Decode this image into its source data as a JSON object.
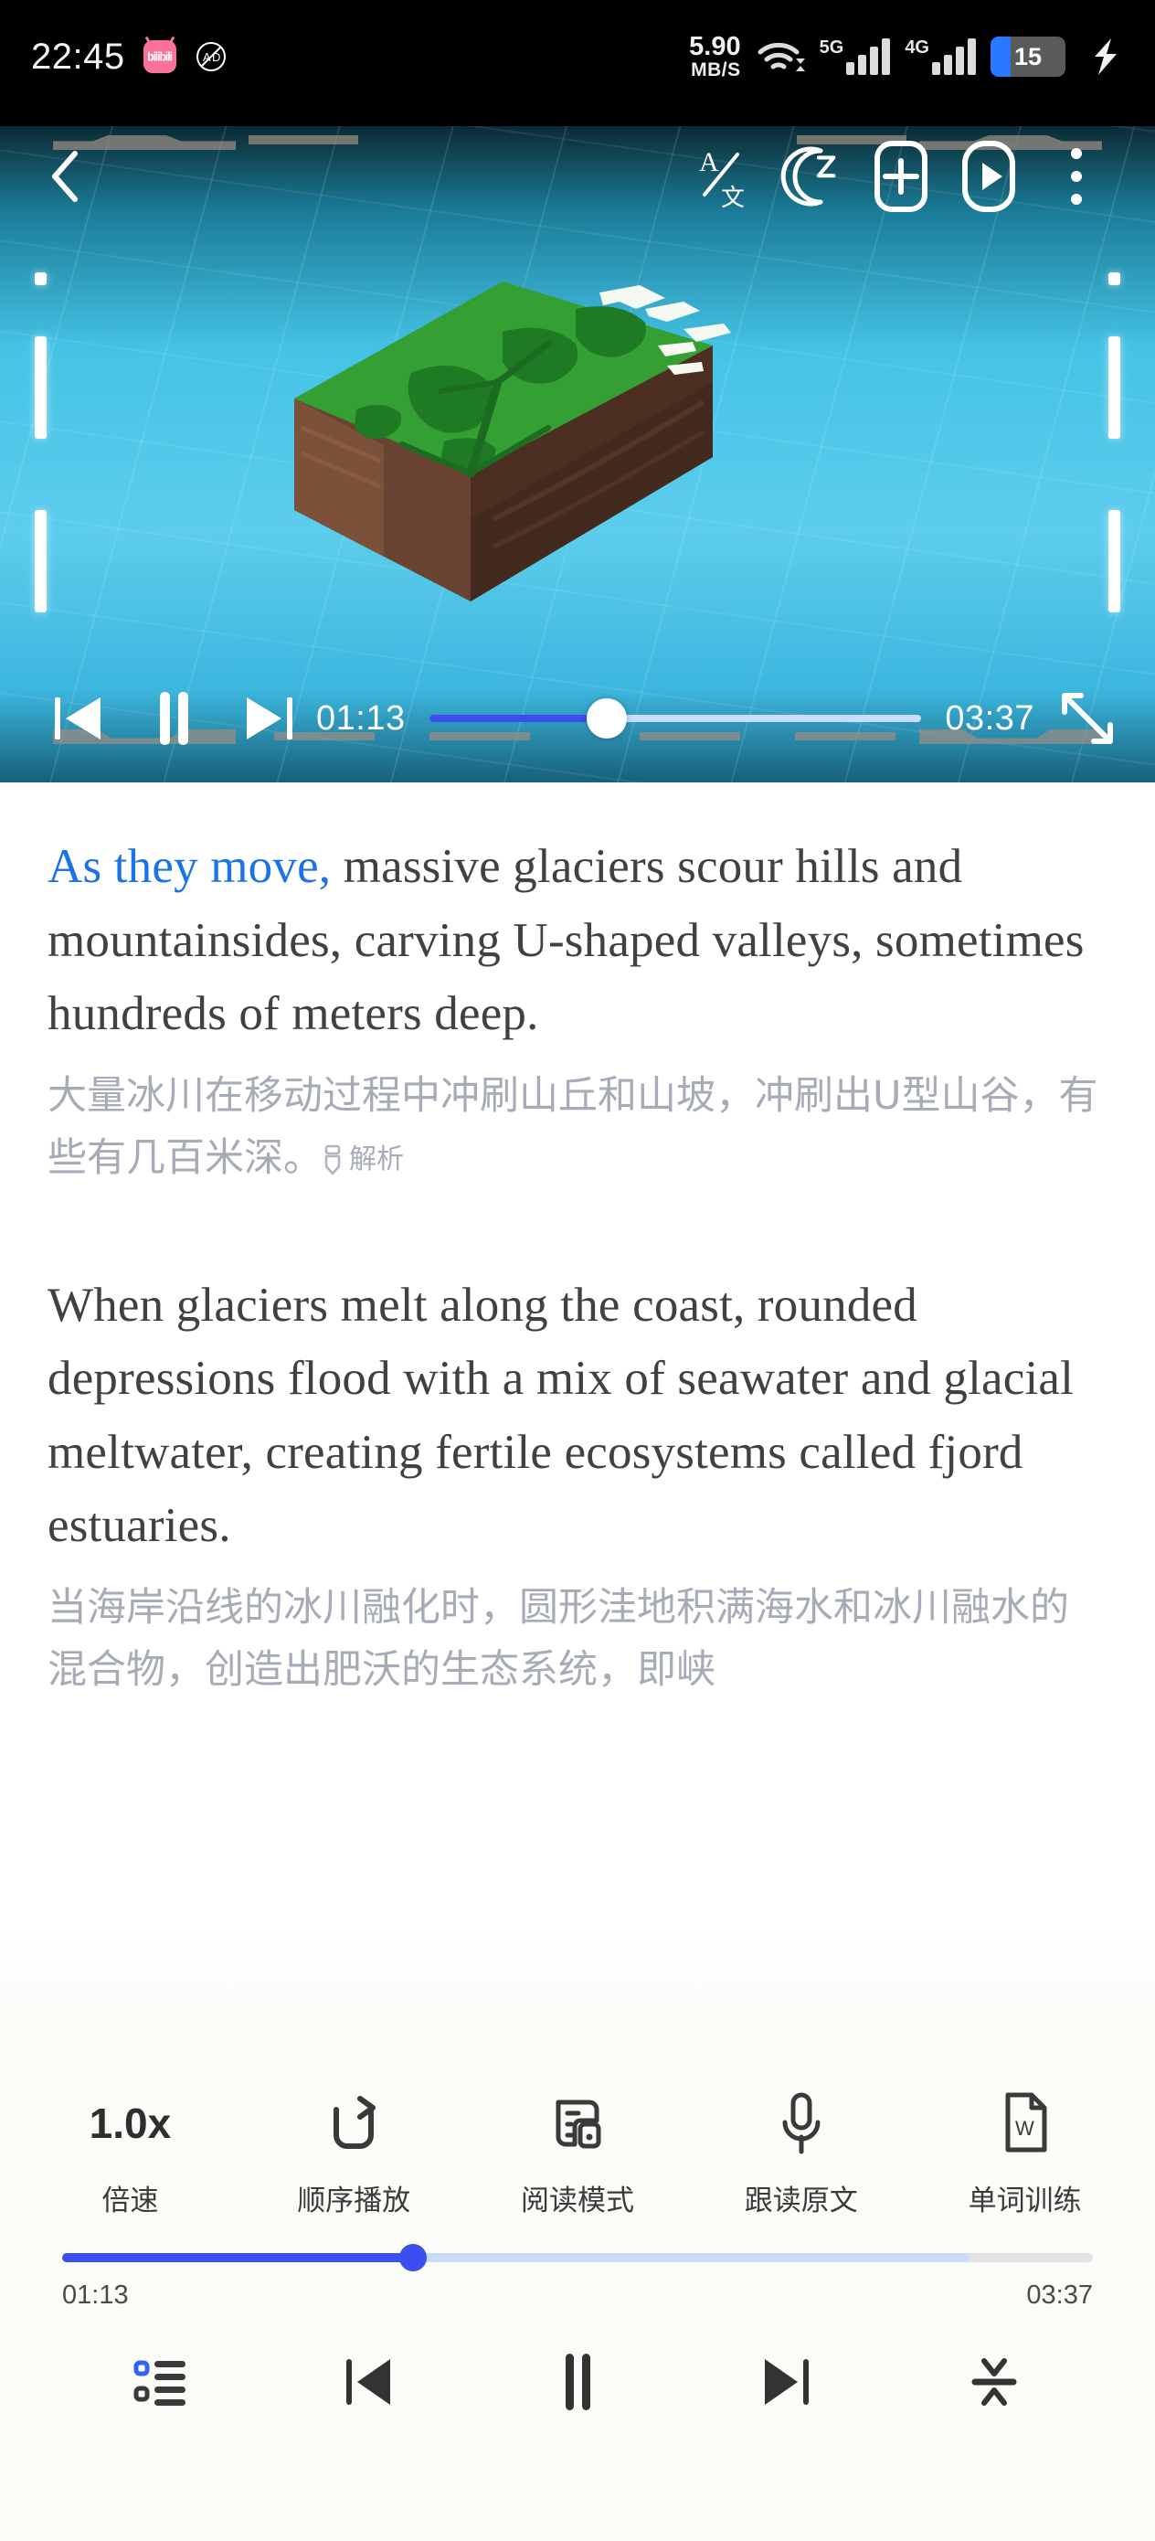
{
  "status_bar": {
    "time": "22:45",
    "bili_label": "bilibili",
    "mute_ad_icon": "no-audio-description-icon",
    "net_speed_value": "5.90",
    "net_speed_unit": "MB/S",
    "wifi_icon": "wifi-icon",
    "sim1_label": "5G",
    "sim2_label": "4G",
    "battery_percent": "15",
    "charging_icon": "lightning-bolt-icon"
  },
  "player": {
    "toolbar": {
      "back_icon": "chevron-left-icon",
      "translate_icon": "translate-a-wen-icon",
      "sleep_timer_icon": "moon-z-sleep-timer-icon",
      "add_icon": "plus-in-card-icon",
      "video_icon": "play-in-card-icon",
      "more_icon": "three-dots-vertical-icon"
    },
    "controls": {
      "prev_icon": "skip-previous-icon",
      "pause_icon": "pause-icon",
      "next_icon": "skip-next-icon",
      "current_time": "01:13",
      "total_time": "03:37",
      "fullscreen_icon": "fullscreen-expand-icon",
      "progress_percent": 36
    },
    "scene": {
      "description": "3d-terrain-cross-section-block",
      "grass_color": "#3aa13a",
      "soil_color": "#5a3a2a",
      "snow_color": "#f4f7ef",
      "sky_color": "#4fc6e8"
    }
  },
  "content": {
    "paragraph1": {
      "highlight": "As they move,",
      "rest": " massive glaciers scour hills and mountainsides, carving U-shaped valleys, sometimes hundreds of meters deep.",
      "translation": "大量冰川在移动过程中冲刷山丘和山坡，冲刷出U型山谷，有些有几百米深。",
      "analysis_label": "解析",
      "analysis_icon": "pen-analysis-icon"
    },
    "paragraph2": {
      "text": "When glaciers melt along the coast, rounded depressions flood with a mix of seawater and glacial meltwater, creating fertile ecosystems called fjord estuaries.",
      "translation": "当海岸沿线的冰川融化时，圆形洼地积满海水和冰川融水的混合物，创造出肥沃的生态系统，即峡"
    }
  },
  "toolbar": {
    "items": [
      {
        "value": "1.0x",
        "label": "倍速",
        "icon": "playback-speed-icon"
      },
      {
        "value": "",
        "label": "顺序播放",
        "icon": "repeat-sequential-icon"
      },
      {
        "value": "",
        "label": "阅读模式",
        "icon": "reading-mode-icon"
      },
      {
        "value": "",
        "label": "跟读原文",
        "icon": "microphone-read-along-icon"
      },
      {
        "value": "",
        "label": "单词训练",
        "icon": "word-document-w-icon"
      }
    ]
  },
  "playback": {
    "current_time": "01:13",
    "total_time": "03:37",
    "progress_percent": 34,
    "buffer_percent": 88,
    "accent_color": "#3b4ef0"
  },
  "navbar": {
    "items": [
      {
        "icon": "playlist-icon"
      },
      {
        "icon": "skip-previous-icon"
      },
      {
        "icon": "pause-icon"
      },
      {
        "icon": "skip-next-icon"
      },
      {
        "icon": "collapse-icon"
      }
    ]
  }
}
